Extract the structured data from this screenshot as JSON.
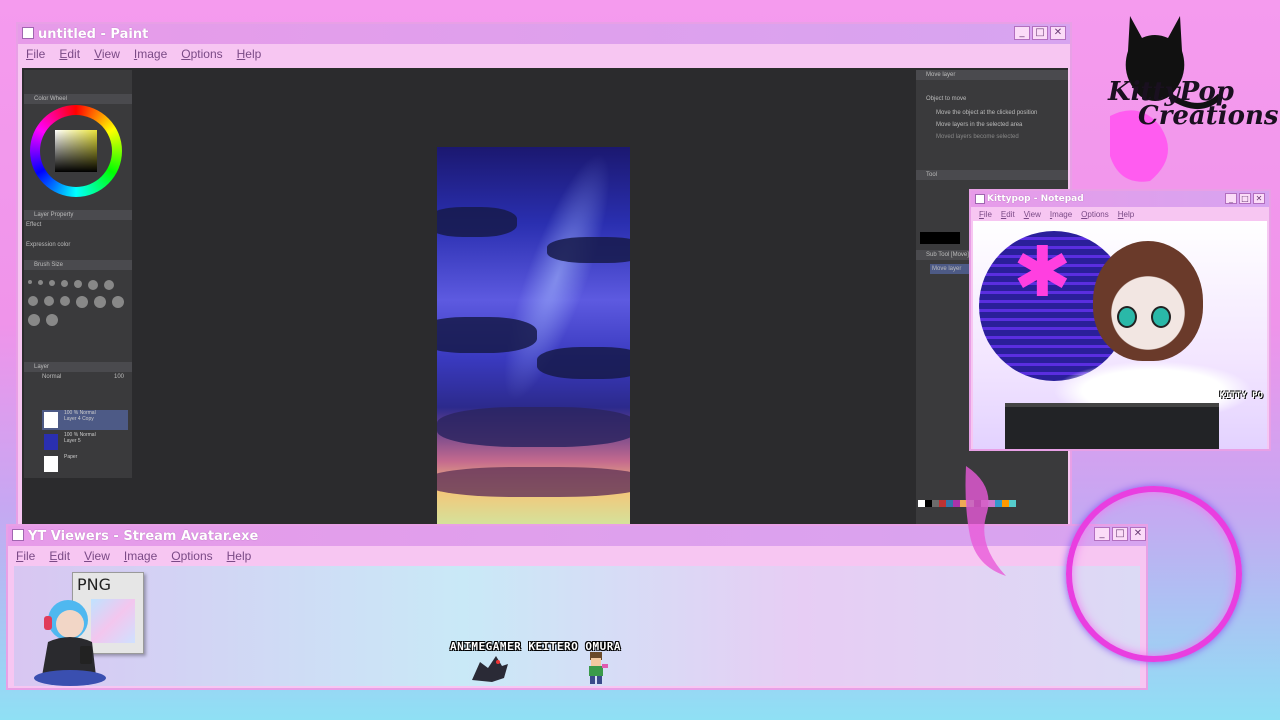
{
  "paint": {
    "title": "untitled - Paint",
    "menu": [
      "File",
      "Edit",
      "View",
      "Image",
      "Options",
      "Help"
    ],
    "controls": {
      "minimize": "_",
      "maximize": "□",
      "close": "✕"
    },
    "left_panel": {
      "color_wheel_label": "Color Wheel",
      "layer_property_label": "Layer Property",
      "effect_label": "Effect",
      "expression_color_label": "Expression color",
      "brush_size_label": "Brush Size",
      "layer_label": "Layer",
      "blend_mode": "Normal",
      "opacity": "100",
      "layers": [
        {
          "mode": "100 % Normal",
          "name": "Layer 4 Copy"
        },
        {
          "mode": "100 % Normal",
          "name": "Layer 5"
        },
        {
          "mode": "",
          "name": "Paper"
        }
      ]
    },
    "right_panel": {
      "header": "Move layer",
      "object_to_move": "Object to move",
      "option1": "Move the object at the clicked position",
      "option2": "Move layers in the selected area",
      "option3": "Moved layers become selected",
      "tool_label": "Tool",
      "subtool_label": "Sub Tool [Move]",
      "subtool_item": "Move layer"
    }
  },
  "notepad": {
    "title": "Kittypop - Notepad",
    "menu": [
      "File",
      "Edit",
      "View",
      "Image",
      "Options",
      "Help"
    ],
    "controls": {
      "minimize": "_",
      "maximize": "□",
      "close": "✕"
    },
    "tag": "KITTY PO"
  },
  "yt": {
    "title": "YT Viewers - Stream Avatar.exe",
    "menu": [
      "File",
      "Edit",
      "View",
      "Image",
      "Options",
      "Help"
    ],
    "controls": {
      "minimize": "_",
      "maximize": "□",
      "close": "✕"
    },
    "png_label": "PNG",
    "viewers": "ANIMEGAMER KEITERO OMURA"
  },
  "branding": {
    "logo_line1": "KittyPop",
    "logo_line2": "Creations"
  },
  "colors": {
    "accent": "#e93ee0",
    "window": "#f7c6f2",
    "canvas_bg": "#2b2b2d"
  }
}
